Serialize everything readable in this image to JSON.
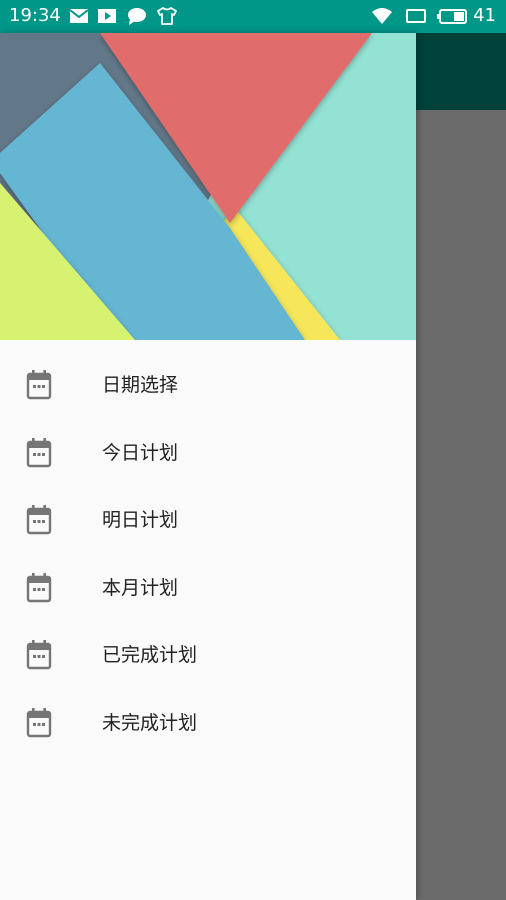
{
  "status_bar": {
    "time": "19:34",
    "battery": "41",
    "icons": [
      "mail-icon",
      "play-icon",
      "chat-icon",
      "shirt-icon",
      "wifi-icon",
      "screen-icon",
      "battery-icon"
    ]
  },
  "colors": {
    "status_bar": "#009688",
    "toolbar": "#00413a",
    "scrim": "#6b6b6b",
    "drawer_bg": "#fafafa",
    "menu_icon": "#757575",
    "menu_text": "#222222",
    "header_gray": "#627788",
    "header_red": "#e06d6c",
    "header_teal": "#93e2d3",
    "header_blue": "#65b6d2",
    "header_yellow": "#f6e65a",
    "header_lime": "#d6f26f"
  },
  "drawer": {
    "menu_items": [
      {
        "label": "日期选择",
        "icon": "calendar-icon"
      },
      {
        "label": "今日计划",
        "icon": "calendar-icon"
      },
      {
        "label": "明日计划",
        "icon": "calendar-icon"
      },
      {
        "label": "本月计划",
        "icon": "calendar-icon"
      },
      {
        "label": "已完成计划",
        "icon": "calendar-icon"
      },
      {
        "label": "未完成计划",
        "icon": "calendar-icon"
      }
    ]
  }
}
